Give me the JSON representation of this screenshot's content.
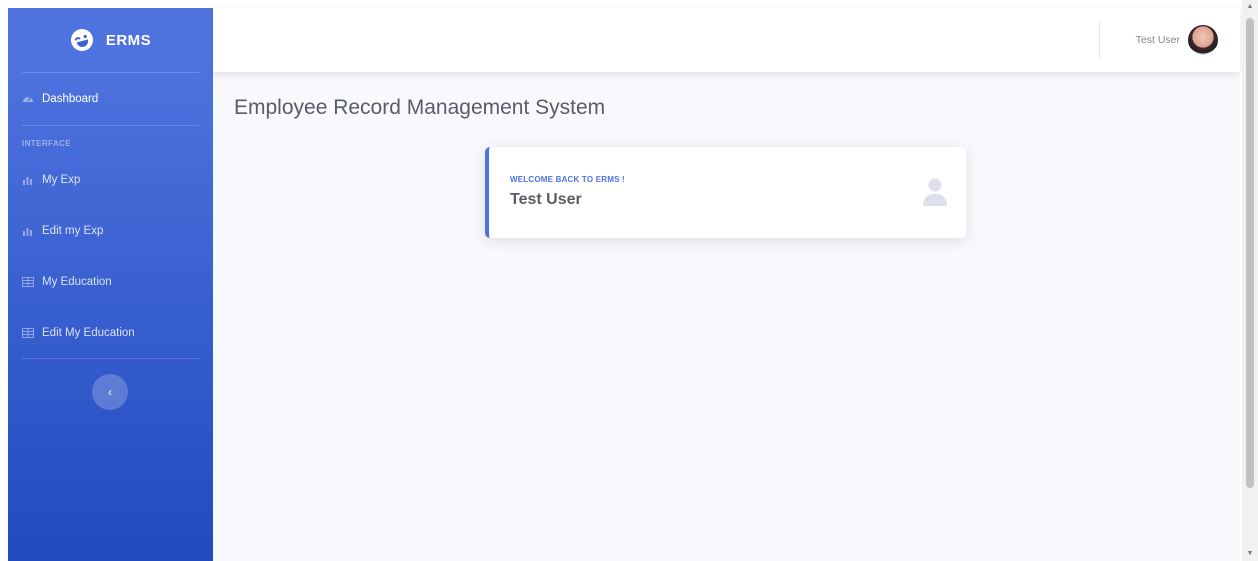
{
  "sidebar": {
    "brand": "ERMS",
    "items": [
      {
        "label": "Dashboard"
      },
      {
        "label": "My Exp"
      },
      {
        "label": "Edit my Exp"
      },
      {
        "label": "My Education"
      },
      {
        "label": "Edit My Education"
      }
    ],
    "heading": "INTERFACE",
    "toggle_glyph": "‹"
  },
  "topbar": {
    "user_name": "Test User"
  },
  "main": {
    "page_title": "Employee Record Management System",
    "card": {
      "label": "Welcome back to ERMS !",
      "value": "Test User"
    }
  },
  "icons": {
    "brand": "laugh-wink-icon",
    "dashboard": "tachometer-icon",
    "exp": "chart-bar-icon",
    "education": "table-icon",
    "card": "user-icon"
  },
  "colors": {
    "primary": "#4e73df",
    "sidebar_end": "#224abe",
    "text_gray": "#5a5c69"
  },
  "scrollbar": {
    "up": "▲",
    "down": "▼"
  }
}
